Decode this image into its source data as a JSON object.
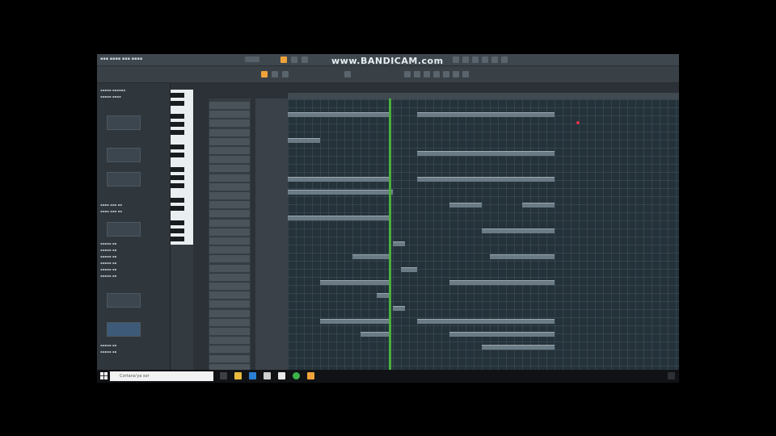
{
  "watermark": "www.BANDICAM.com",
  "taskbar": {
    "search_placeholder": "Cortana'ya sor",
    "clock_time": "",
    "clock_date": ""
  },
  "colors": {
    "accent": "#f0a23a",
    "playhead": "#4caf3f",
    "marker": "#e0344c"
  },
  "icons": [
    "windows-start-icon",
    "search-icon",
    "task-view-icon",
    "file-explorer-icon",
    "edge-icon",
    "store-icon",
    "mail-icon",
    "chrome-icon",
    "fl-studio-icon",
    "notification-icon"
  ]
}
